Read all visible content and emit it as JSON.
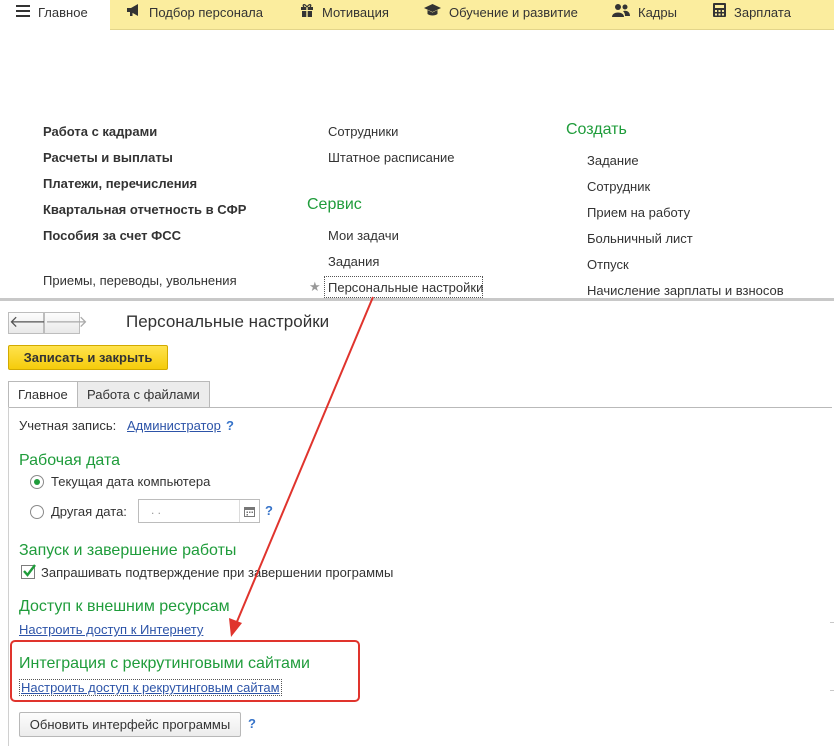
{
  "topbar": {
    "items": [
      {
        "label": "Главное",
        "icon": "hamburger-menu-icon"
      },
      {
        "label": "Подбор персонала",
        "icon": "megaphone-icon"
      },
      {
        "label": "Мотивация",
        "icon": "gift-icon"
      },
      {
        "label": "Обучение и развитие",
        "icon": "graduation-cap-icon"
      },
      {
        "label": "Кадры",
        "icon": "people-icon"
      },
      {
        "label": "Зарплата",
        "icon": "calculator-icon"
      }
    ]
  },
  "functions_panel": {
    "left_column": [
      "Работа с кадрами",
      "Расчеты и выплаты",
      "Платежи, перечисления",
      "Квартальная отчетность в СФР",
      "Пособия за счет ФСС"
    ],
    "left_plain": "Приемы, переводы, увольнения",
    "middle_top": [
      "Сотрудники",
      "Штатное расписание"
    ],
    "service_heading": "Сервис",
    "service_items": [
      "Мои задачи",
      "Задания",
      "Персональные настройки"
    ],
    "create_heading": "Создать",
    "create_items": [
      "Задание",
      "Сотрудник",
      "Прием на работу",
      "Больничный лист",
      "Отпуск",
      "Начисление зарплаты и взносов"
    ]
  },
  "form": {
    "title": "Персональные настройки",
    "save_close_label": "Записать и закрыть",
    "tabs": [
      {
        "label": "Главное",
        "active": true
      },
      {
        "label": "Работа с файлами",
        "active": false
      }
    ],
    "account_label": "Учетная запись:",
    "account_value": "Администратор",
    "help_mark": "?",
    "work_date": {
      "heading": "Рабочая дата",
      "option_computer": "Текущая дата компьютера",
      "option_other": "Другая дата:",
      "selected": "computer",
      "date_placeholder": " .  ."
    },
    "startup": {
      "heading": "Запуск и завершение работы",
      "confirm_exit_label": "Запрашивать подтверждение при завершении программы",
      "confirm_exit_checked": true
    },
    "external": {
      "heading": "Доступ к внешним ресурсам",
      "internet_link": "Настроить доступ к Интернету"
    },
    "recruiting": {
      "heading": "Интеграция с рекрутинговыми сайтами",
      "link": "Настроить доступ к рекрутинговым сайтам"
    },
    "update_button_label": "Обновить интерфейс программы"
  },
  "colors": {
    "topbar_bg": "#fbed9e",
    "section_green": "#1f9c3b",
    "link_blue": "#2d54a8",
    "annotation_red": "#e0342d",
    "save_button_yellow": "#f5cc0b"
  }
}
